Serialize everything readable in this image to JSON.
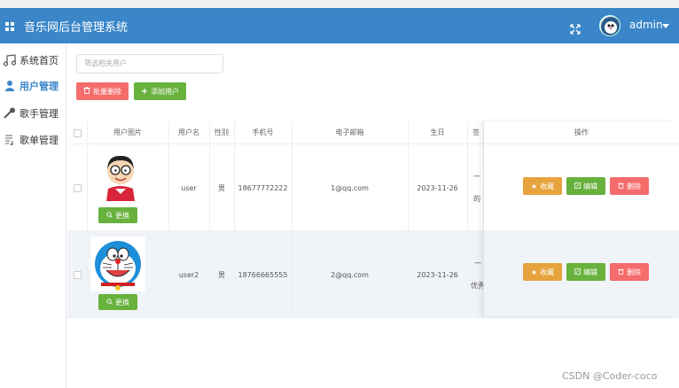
{
  "app": {
    "title": "音乐网后台管理系统",
    "user": "admin"
  },
  "sidebar": {
    "items": [
      {
        "label": "系统首页",
        "icon": "music-note-icon"
      },
      {
        "label": "用户管理",
        "icon": "user-icon"
      },
      {
        "label": "歌手管理",
        "icon": "microphone-icon"
      },
      {
        "label": "歌单管理",
        "icon": "playlist-icon"
      }
    ]
  },
  "toolbar": {
    "search_placeholder": "筛选相关用户",
    "batch_delete_label": "批量删除",
    "add_user_label": "添加用户"
  },
  "table": {
    "columns": [
      "用户图片",
      "用户名",
      "性别",
      "手机号",
      "电子邮箱",
      "生日",
      "签",
      "操作"
    ],
    "change_label": "更换",
    "actions": {
      "collect": "收藏",
      "edit": "编辑",
      "delete": "删除"
    },
    "rows": [
      {
        "username": "user",
        "gender": "男",
        "phone": "18677772222",
        "email": "1@qq.com",
        "birthday": "2023-11-26",
        "sig_top": "一",
        "sig_bottom": "的",
        "avatar": "nobita-avatar"
      },
      {
        "username": "user2",
        "gender": "男",
        "phone": "18766665555",
        "email": "2@qq.com",
        "birthday": "2023-11-26",
        "sig_top": "一",
        "sig_bottom": "优秀",
        "avatar": "doraemon-avatar"
      }
    ]
  },
  "watermark": "CSDN @Coder-coco",
  "colors": {
    "header": "#3a86c8",
    "danger": "#f56c6c",
    "success": "#67b13d",
    "warning": "#e6a23c"
  }
}
